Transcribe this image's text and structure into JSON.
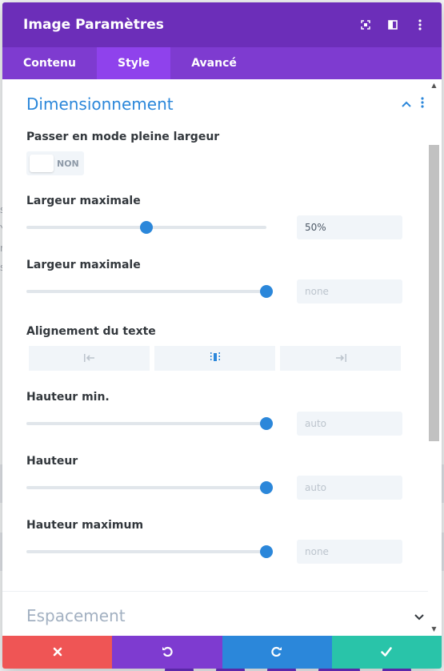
{
  "background": {
    "fragments": [
      "s",
      "Y",
      "n",
      "s"
    ]
  },
  "header": {
    "title": "Image Paramètres",
    "icons": [
      "expand-icon",
      "split-view-icon",
      "more-vertical-icon"
    ]
  },
  "tabs": [
    {
      "label": "Contenu",
      "active": false
    },
    {
      "label": "Style",
      "active": true
    },
    {
      "label": "Avancé",
      "active": false
    }
  ],
  "section": {
    "title": "Dimensionnement",
    "icons": [
      "chevron-up-icon",
      "more-vertical-icon"
    ]
  },
  "fields": {
    "fullwidth": {
      "label": "Passer en mode pleine largeur",
      "toggle_text": "NON",
      "enabled": false
    },
    "max_width_1": {
      "label": "Largeur maximale",
      "value": "50%",
      "placeholder": "",
      "slider_percent": 50
    },
    "max_width_2": {
      "label": "Largeur maximale",
      "value": "",
      "placeholder": "none",
      "slider_percent": 100
    },
    "text_align": {
      "label": "Alignement du texte",
      "options": [
        "align-left-icon",
        "align-center-icon",
        "align-right-icon"
      ],
      "selected": "align-center-icon"
    },
    "min_height": {
      "label": "Hauteur min.",
      "value": "",
      "placeholder": "auto",
      "slider_percent": 100
    },
    "height": {
      "label": "Hauteur",
      "value": "",
      "placeholder": "auto",
      "slider_percent": 100
    },
    "max_height": {
      "label": "Hauteur maximum",
      "value": "",
      "placeholder": "none",
      "slider_percent": 100
    }
  },
  "collapsed_section": {
    "title": "Espacement",
    "icon": "chevron-down-icon"
  },
  "footer": {
    "buttons": [
      {
        "name": "cancel-button",
        "icon": "close-icon",
        "color": "#ef5555"
      },
      {
        "name": "undo-button",
        "icon": "undo-icon",
        "color": "#7e3bd0"
      },
      {
        "name": "redo-button",
        "icon": "redo-icon",
        "color": "#2b87da"
      },
      {
        "name": "save-button",
        "icon": "check-icon",
        "color": "#29c4a9"
      }
    ]
  },
  "colors": {
    "header": "#6c2eb9",
    "tabs": "#7e3bd0",
    "tab_active": "#8f42ec",
    "accent": "#2b87da"
  }
}
